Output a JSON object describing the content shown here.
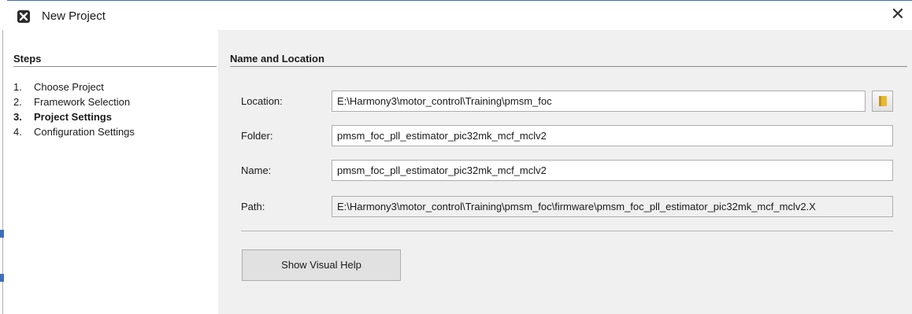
{
  "window": {
    "title": "New Project",
    "icons": {
      "app": "app-logo-icon",
      "close": "close-icon"
    }
  },
  "steps": {
    "title": "Steps",
    "items": [
      {
        "number": "1.",
        "label": "Choose Project",
        "current": false
      },
      {
        "number": "2.",
        "label": "Framework Selection",
        "current": false
      },
      {
        "number": "3.",
        "label": "Project Settings",
        "current": true
      },
      {
        "number": "4.",
        "label": "Configuration Settings",
        "current": false
      }
    ]
  },
  "form": {
    "section_title": "Name and Location",
    "location": {
      "label": "Location:",
      "value": "E:\\Harmony3\\motor_control\\Training\\pmsm_foc"
    },
    "folder": {
      "label": "Folder:",
      "value": "pmsm_foc_pll_estimator_pic32mk_mcf_mclv2"
    },
    "name": {
      "label": "Name:",
      "value": "pmsm_foc_pll_estimator_pic32mk_mcf_mclv2"
    },
    "path": {
      "label": "Path:",
      "value": "E:\\Harmony3\\motor_control\\Training\\pmsm_foc\\firmware\\pmsm_foc_pll_estimator_pic32mk_mcf_mclv2.X"
    },
    "browse_icon": "folder-icon",
    "help_button": "Show Visual Help"
  },
  "colors": {
    "accent": "#3d6fb8",
    "panel_bg": "#f0f0f0",
    "folder": "#e8b930"
  }
}
